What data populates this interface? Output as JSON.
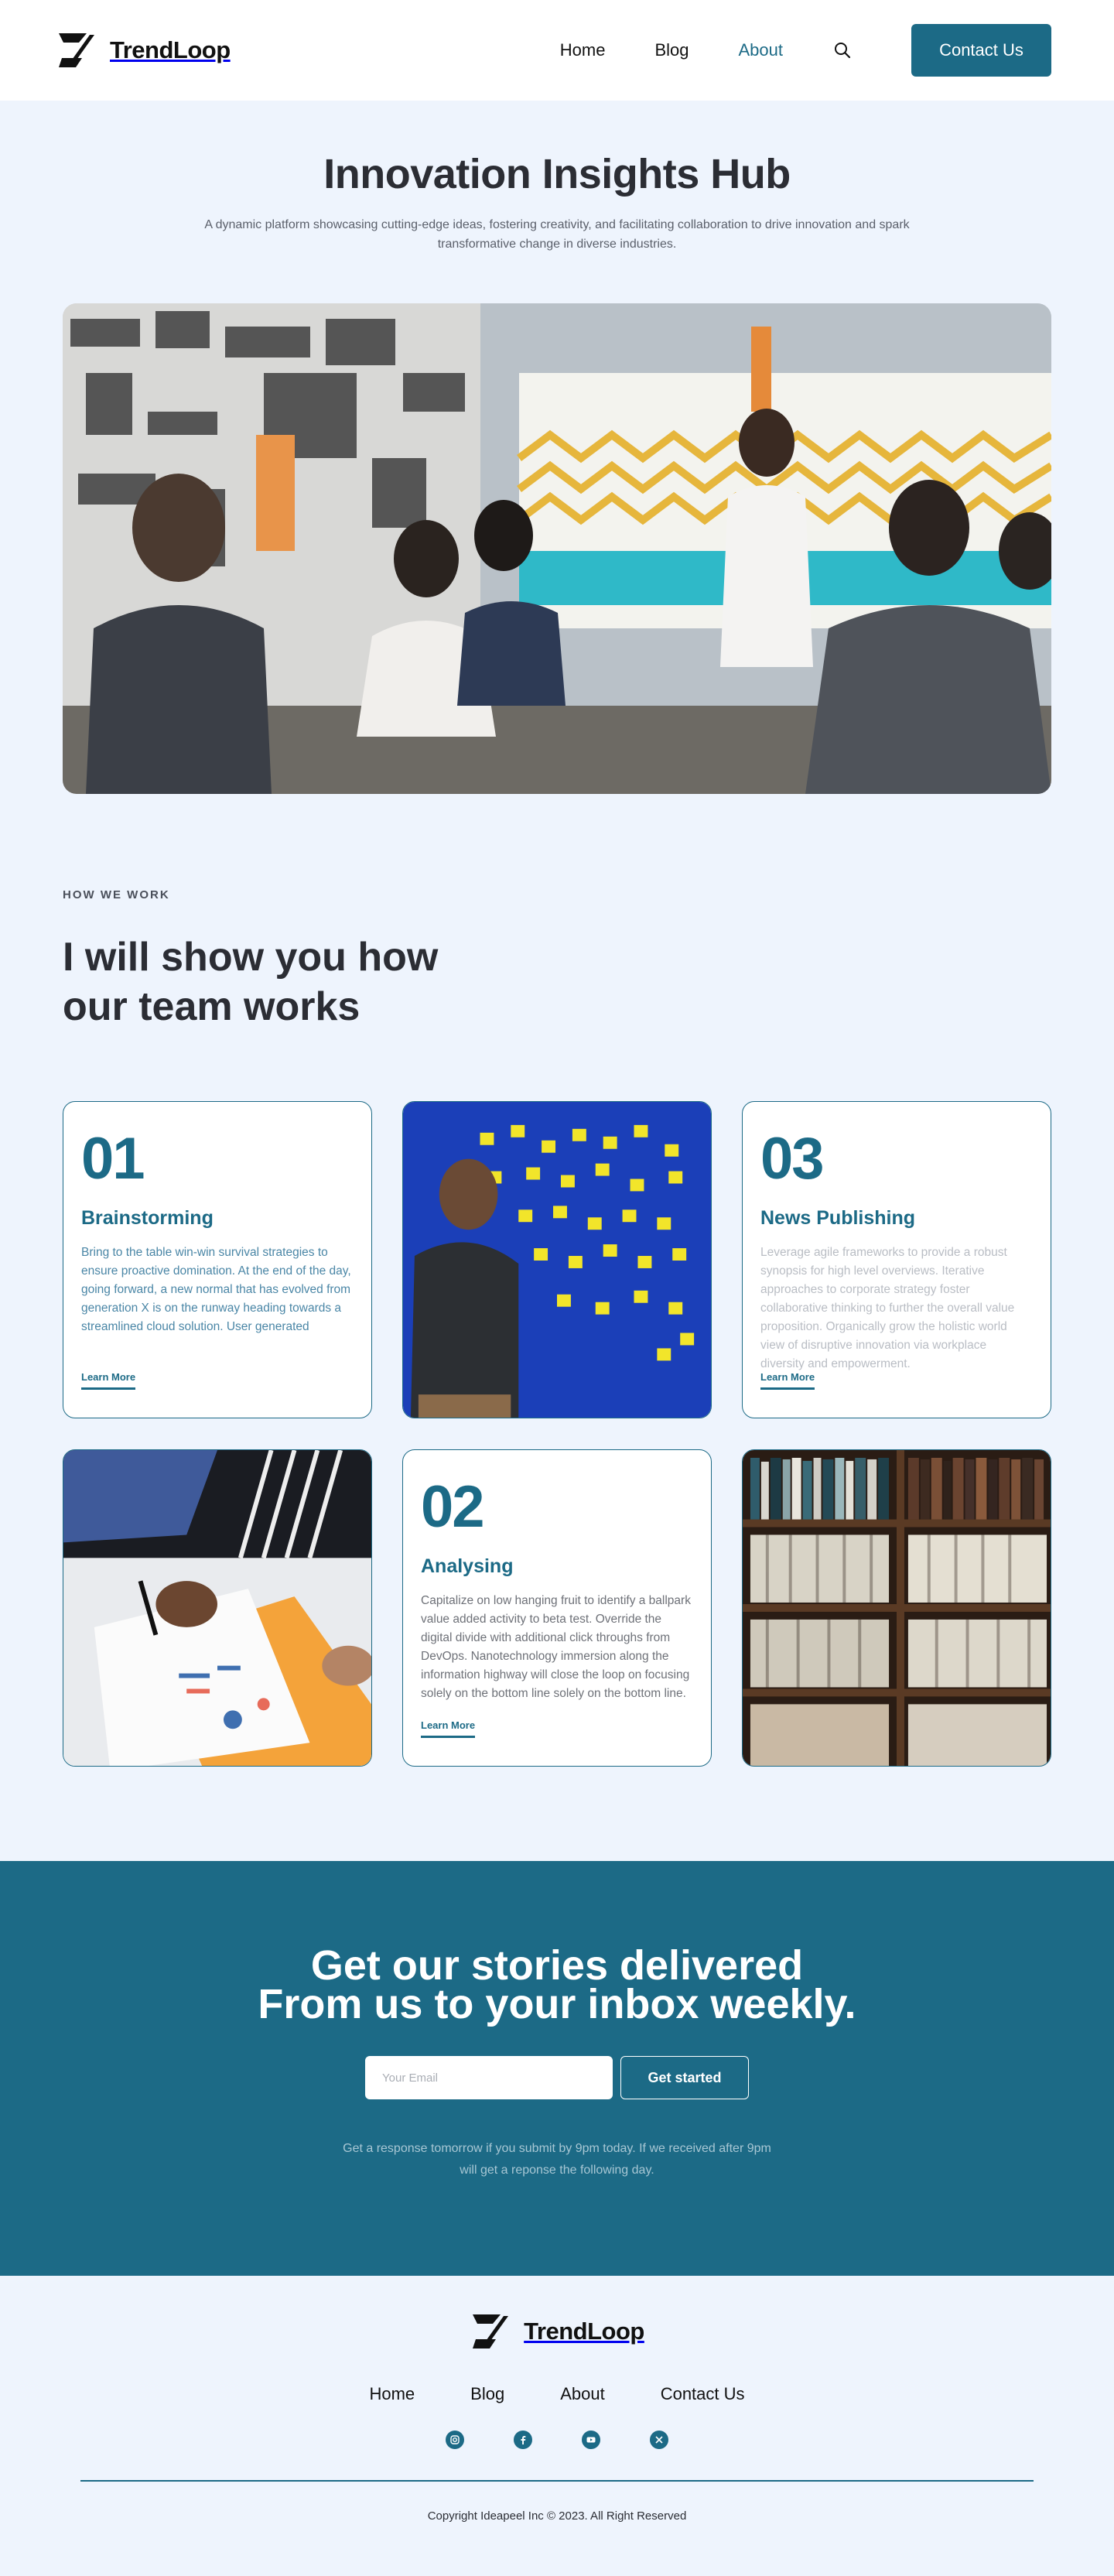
{
  "brand": {
    "name": "TrendLoop"
  },
  "nav": {
    "items": [
      {
        "label": "Home"
      },
      {
        "label": "Blog"
      },
      {
        "label": "About"
      }
    ],
    "active": "About",
    "contact_label": "Contact Us"
  },
  "hero": {
    "title": "Innovation Insights Hub",
    "subtitle": "A dynamic platform showcasing cutting-edge ideas, fostering creativity, and facilitating collaboration to drive innovation and spark transformative change in diverse industries."
  },
  "how": {
    "eyebrow": "HOW WE WORK",
    "heading": "I will show you how our team works",
    "cards": [
      {
        "number": "01",
        "title": "Brainstorming",
        "body": "Bring to the table win-win survival strategies to ensure proactive domination. At the end of the day, going forward, a new normal that has evolved from generation X is on the runway heading towards a streamlined cloud solution. User generated",
        "link": "Learn More"
      },
      {
        "number": "03",
        "title": "News Publishing",
        "body": "Leverage agile frameworks to provide a robust synopsis for high level overviews. Iterative approaches to corporate strategy foster collaborative thinking to further the overall value proposition. Organically grow the holistic world view of disruptive innovation via workplace diversity and empowerment.",
        "link": "Learn More"
      },
      {
        "number": "02",
        "title": "Analysing",
        "body": "Capitalize on low hanging fruit to identify a ballpark value added activity to beta test. Override the digital divide with additional click throughs from DevOps. Nanotechnology immersion along the information highway will close the loop on focusing solely on the bottom line solely on the bottom line.",
        "link": "Learn More"
      }
    ]
  },
  "newsletter": {
    "heading": "Get our stories delivered From us to your inbox weekly.",
    "email_placeholder": "Your Email",
    "button": "Get started",
    "note": "Get a response tomorrow if you submit by 9pm today. If we received after 9pm will get a reponse the following day."
  },
  "footer": {
    "nav": [
      {
        "label": "Home"
      },
      {
        "label": "Blog"
      },
      {
        "label": "About"
      },
      {
        "label": "Contact Us"
      }
    ],
    "social": [
      "instagram-icon",
      "facebook-icon",
      "youtube-icon",
      "x-icon"
    ],
    "copyright": "Copyright Ideapeel Inc © 2023. All Right Reserved"
  },
  "colors": {
    "primary": "#1c6a86",
    "page_bg": "#eef4fd",
    "heading": "#2b2d34"
  }
}
